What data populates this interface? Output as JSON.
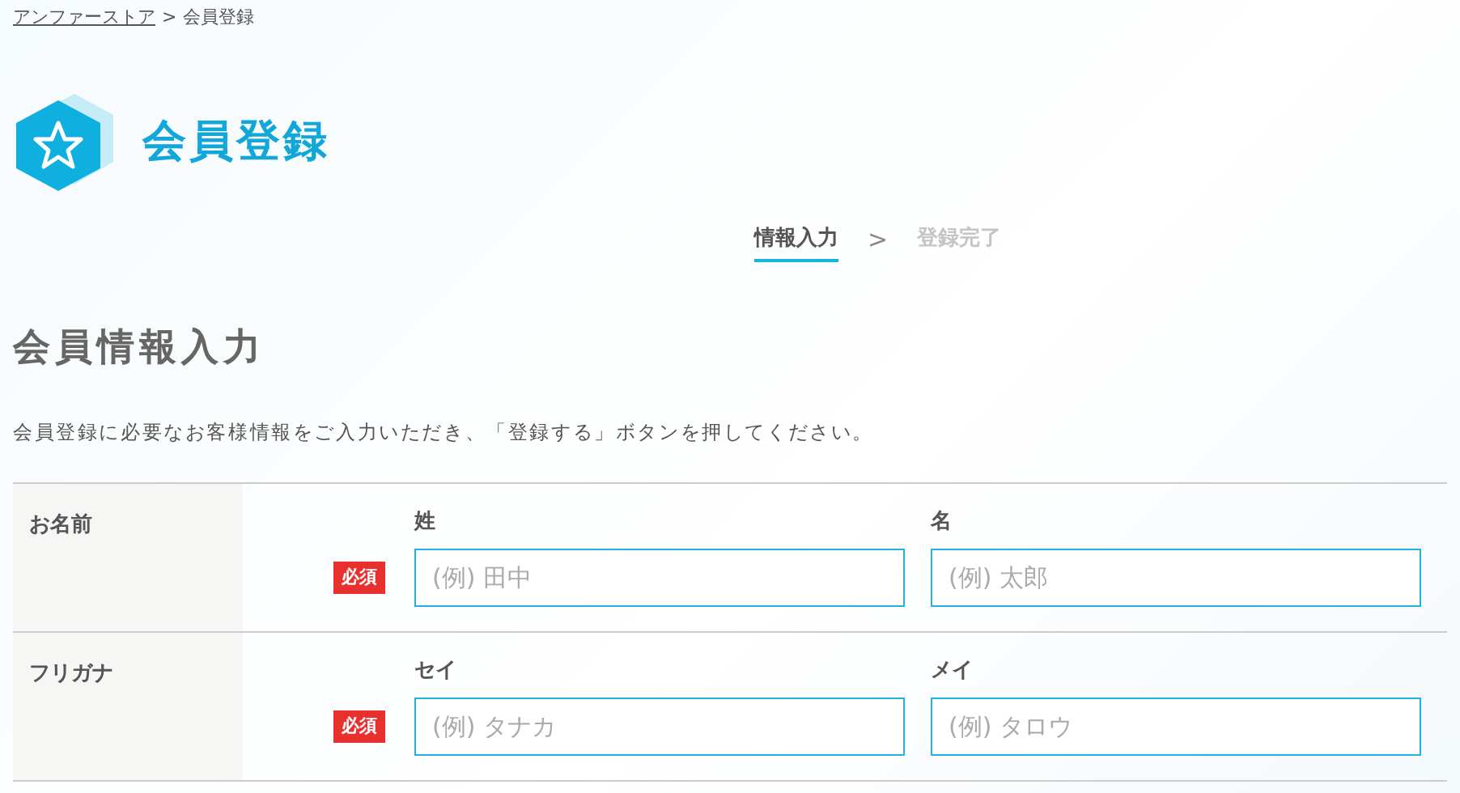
{
  "breadcrumb": [
    {
      "label": "アンファーストア",
      "link": true
    },
    {
      "label": "会員登録",
      "link": false
    }
  ],
  "breadcrumb_separator": ">",
  "page_title": "会員登録",
  "steps": [
    {
      "label": "情報入力",
      "selected": true
    },
    {
      "label": "登録完了",
      "selected": false
    }
  ],
  "step_separator": ">",
  "section_title": "会員情報入力",
  "description": "会員登録に必要なお客様情報をご入力いただき、「登録する」ボタンを押してください。",
  "form_rows": [
    {
      "label": "お名前",
      "required": true,
      "badge": "必須",
      "fields": [
        {
          "label": "姓",
          "placeholder": "(例) 田中"
        },
        {
          "label": "名",
          "placeholder": "(例) 太郎"
        }
      ]
    },
    {
      "label": "フリガナ",
      "required": true,
      "badge": "必須",
      "fields": [
        {
          "label": "セイ",
          "placeholder": "(例) タナカ"
        },
        {
          "label": "メイ",
          "placeholder": "(例) タロウ"
        }
      ]
    }
  ]
}
